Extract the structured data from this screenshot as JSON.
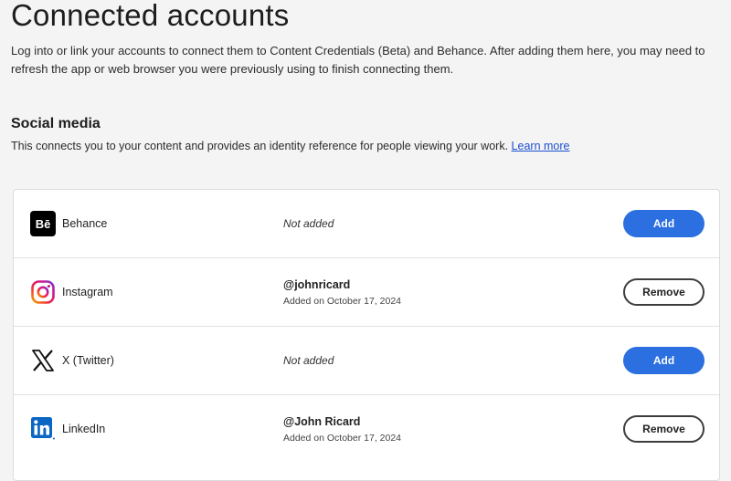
{
  "page": {
    "title": "Connected accounts",
    "intro": "Log into or link your accounts to connect them to Content Credentials (Beta) and Behance. After adding them here, you may need to refresh the app or web browser you were previously using to finish connecting them."
  },
  "social_media": {
    "title": "Social media",
    "description": "This connects you to your content and provides an identity reference for people viewing your work.",
    "learn_more": "Learn more"
  },
  "accounts": [
    {
      "name": "Behance",
      "icon": "behance-icon",
      "status": "Not added",
      "action": "Add"
    },
    {
      "name": "Instagram",
      "icon": "instagram-icon",
      "handle": "@johnricard",
      "added_on": "Added on October 17, 2024",
      "action": "Remove"
    },
    {
      "name": "X (Twitter)",
      "icon": "x-twitter-icon",
      "status": "Not added",
      "action": "Add"
    },
    {
      "name": "LinkedIn",
      "icon": "linkedin-icon",
      "handle": "@John Ricard",
      "added_on": "Added on October 17, 2024",
      "action": "Remove"
    }
  ],
  "colors": {
    "primary_button": "#2b6fe0",
    "link": "#1a4fcf",
    "background": "#f4f4f4",
    "card": "#ffffff"
  }
}
